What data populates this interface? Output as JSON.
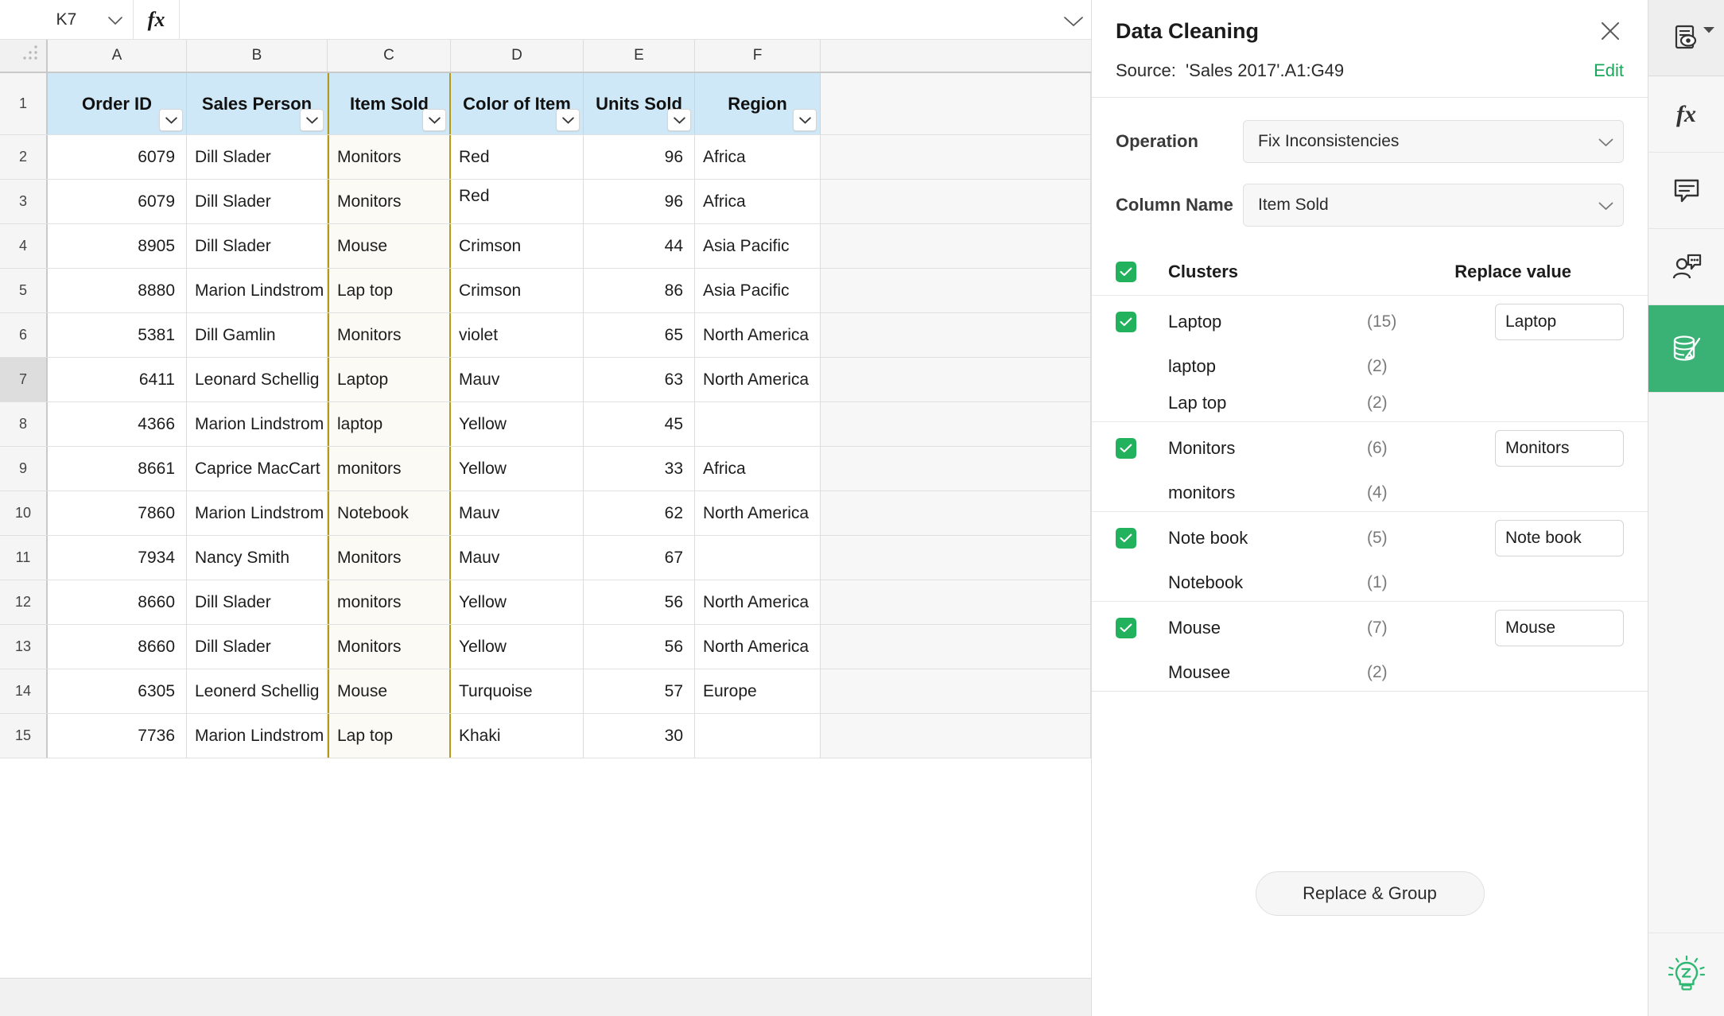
{
  "formula_bar": {
    "cell_ref": "K7",
    "fx_label": "fx",
    "formula_value": "",
    "name_caret_icon": "chevron-down-icon",
    "expand_icon": "chevron-down-icon"
  },
  "sheet": {
    "column_letters": [
      "A",
      "B",
      "C",
      "D",
      "E",
      "F"
    ],
    "header_row_number": "1",
    "headers": [
      "Order ID",
      "Sales Person",
      "Item Sold",
      "Color of Item",
      "Units Sold",
      "Region"
    ],
    "filter_icon": "chevron-down-icon",
    "selected_row": "7",
    "highlighted_column": "C",
    "rows": [
      {
        "n": "2",
        "a": "6079",
        "b": "Dill Slader",
        "c": "Monitors",
        "d": "Red",
        "e": "96",
        "f": "Africa"
      },
      {
        "n": "3",
        "a": "6079",
        "b": "Dill Slader",
        "c": "Monitors",
        "d": "Red",
        "e": "96",
        "f": "Africa"
      },
      {
        "n": "4",
        "a": "8905",
        "b": "Dill Slader",
        "c": "Mouse",
        "d": "Crimson",
        "e": "44",
        "f": "Asia Pacific"
      },
      {
        "n": "5",
        "a": "8880",
        "b": "Marion Lindstrom",
        "c": "Lap top",
        "d": "Crimson",
        "e": "86",
        "f": "Asia Pacific"
      },
      {
        "n": "6",
        "a": "5381",
        "b": "Dill Gamlin",
        "c": "Monitors",
        "d": "violet",
        "e": "65",
        "f": "North America"
      },
      {
        "n": "7",
        "a": "6411",
        "b": "Leonard Schellig",
        "c": "Laptop",
        "d": "Mauv",
        "e": "63",
        "f": "North America"
      },
      {
        "n": "8",
        "a": "4366",
        "b": "Marion Lindstrom",
        "c": "laptop",
        "d": "Yellow",
        "e": "45",
        "f": ""
      },
      {
        "n": "9",
        "a": "8661",
        "b": "Caprice MacCart",
        "c": "monitors",
        "d": "Yellow",
        "e": "33",
        "f": "Africa"
      },
      {
        "n": "10",
        "a": "7860",
        "b": "Marion Lindstrom",
        "c": "Notebook",
        "d": "Mauv",
        "e": "62",
        "f": "North America"
      },
      {
        "n": "11",
        "a": "7934",
        "b": "Nancy Smith",
        "c": "Monitors",
        "d": "Mauv",
        "e": "67",
        "f": ""
      },
      {
        "n": "12",
        "a": "8660",
        "b": "Dill Slader",
        "c": "monitors",
        "d": "Yellow",
        "e": "56",
        "f": "North America"
      },
      {
        "n": "13",
        "a": "8660",
        "b": "Dill Slader",
        "c": "Monitors",
        "d": "Yellow",
        "e": "56",
        "f": "North America"
      },
      {
        "n": "14",
        "a": "6305",
        "b": "Leonerd Schellig",
        "c": "Mouse",
        "d": "Turquoise",
        "e": "57",
        "f": "Europe"
      },
      {
        "n": "15",
        "a": "7736",
        "b": "Marion Lindstrom",
        "c": "Lap top",
        "d": "Khaki",
        "e": "30",
        "f": ""
      }
    ]
  },
  "panel": {
    "title": "Data Cleaning",
    "close_icon": "close-icon",
    "source_label": "Source:",
    "source_value": "'Sales 2017'.A1:G49",
    "edit_label": "Edit",
    "operation_label": "Operation",
    "operation_value": "Fix Inconsistencies",
    "operation_caret_icon": "chevron-down-icon",
    "column_label": "Column Name",
    "column_value": "Item Sold",
    "column_caret_icon": "chevron-down-icon",
    "clusters_header": "Clusters",
    "replace_header": "Replace value",
    "select_all_checked": true,
    "clusters": [
      {
        "checked": true,
        "primary": {
          "name": "Laptop",
          "count": "(15)"
        },
        "replace_value": "Laptop",
        "variants": [
          {
            "name": "laptop",
            "count": "(2)"
          },
          {
            "name": "Lap top",
            "count": "(2)"
          }
        ]
      },
      {
        "checked": true,
        "primary": {
          "name": "Monitors",
          "count": "(6)"
        },
        "replace_value": "Monitors",
        "variants": [
          {
            "name": "monitors",
            "count": "(4)"
          }
        ]
      },
      {
        "checked": true,
        "primary": {
          "name": "Note book",
          "count": "(5)"
        },
        "replace_value": "Note book",
        "variants": [
          {
            "name": "Notebook",
            "count": "(1)"
          }
        ]
      },
      {
        "checked": true,
        "primary": {
          "name": "Mouse",
          "count": "(7)"
        },
        "replace_value": "Mouse",
        "variants": [
          {
            "name": "Mousee",
            "count": "(2)"
          }
        ]
      }
    ],
    "replace_button": "Replace & Group"
  },
  "rail": {
    "items": [
      {
        "icon": "preview-document-icon",
        "active": false,
        "has_caret": true
      },
      {
        "icon": "fx-functions-icon",
        "active": false,
        "label": "fx"
      },
      {
        "icon": "comment-icon",
        "active": false
      },
      {
        "icon": "collaborate-user-icon",
        "active": false
      },
      {
        "icon": "data-cleaning-icon",
        "active": true
      }
    ],
    "zia_icon": "zia-lightbulb-icon",
    "accent_color": "#3ab275",
    "active_color": "#3ab275"
  },
  "colors": {
    "header_fill": "#cfe8f7",
    "highlight_column_border": "#b59a16",
    "green_accent": "#22b15c",
    "edit_green": "#1aa65b"
  }
}
